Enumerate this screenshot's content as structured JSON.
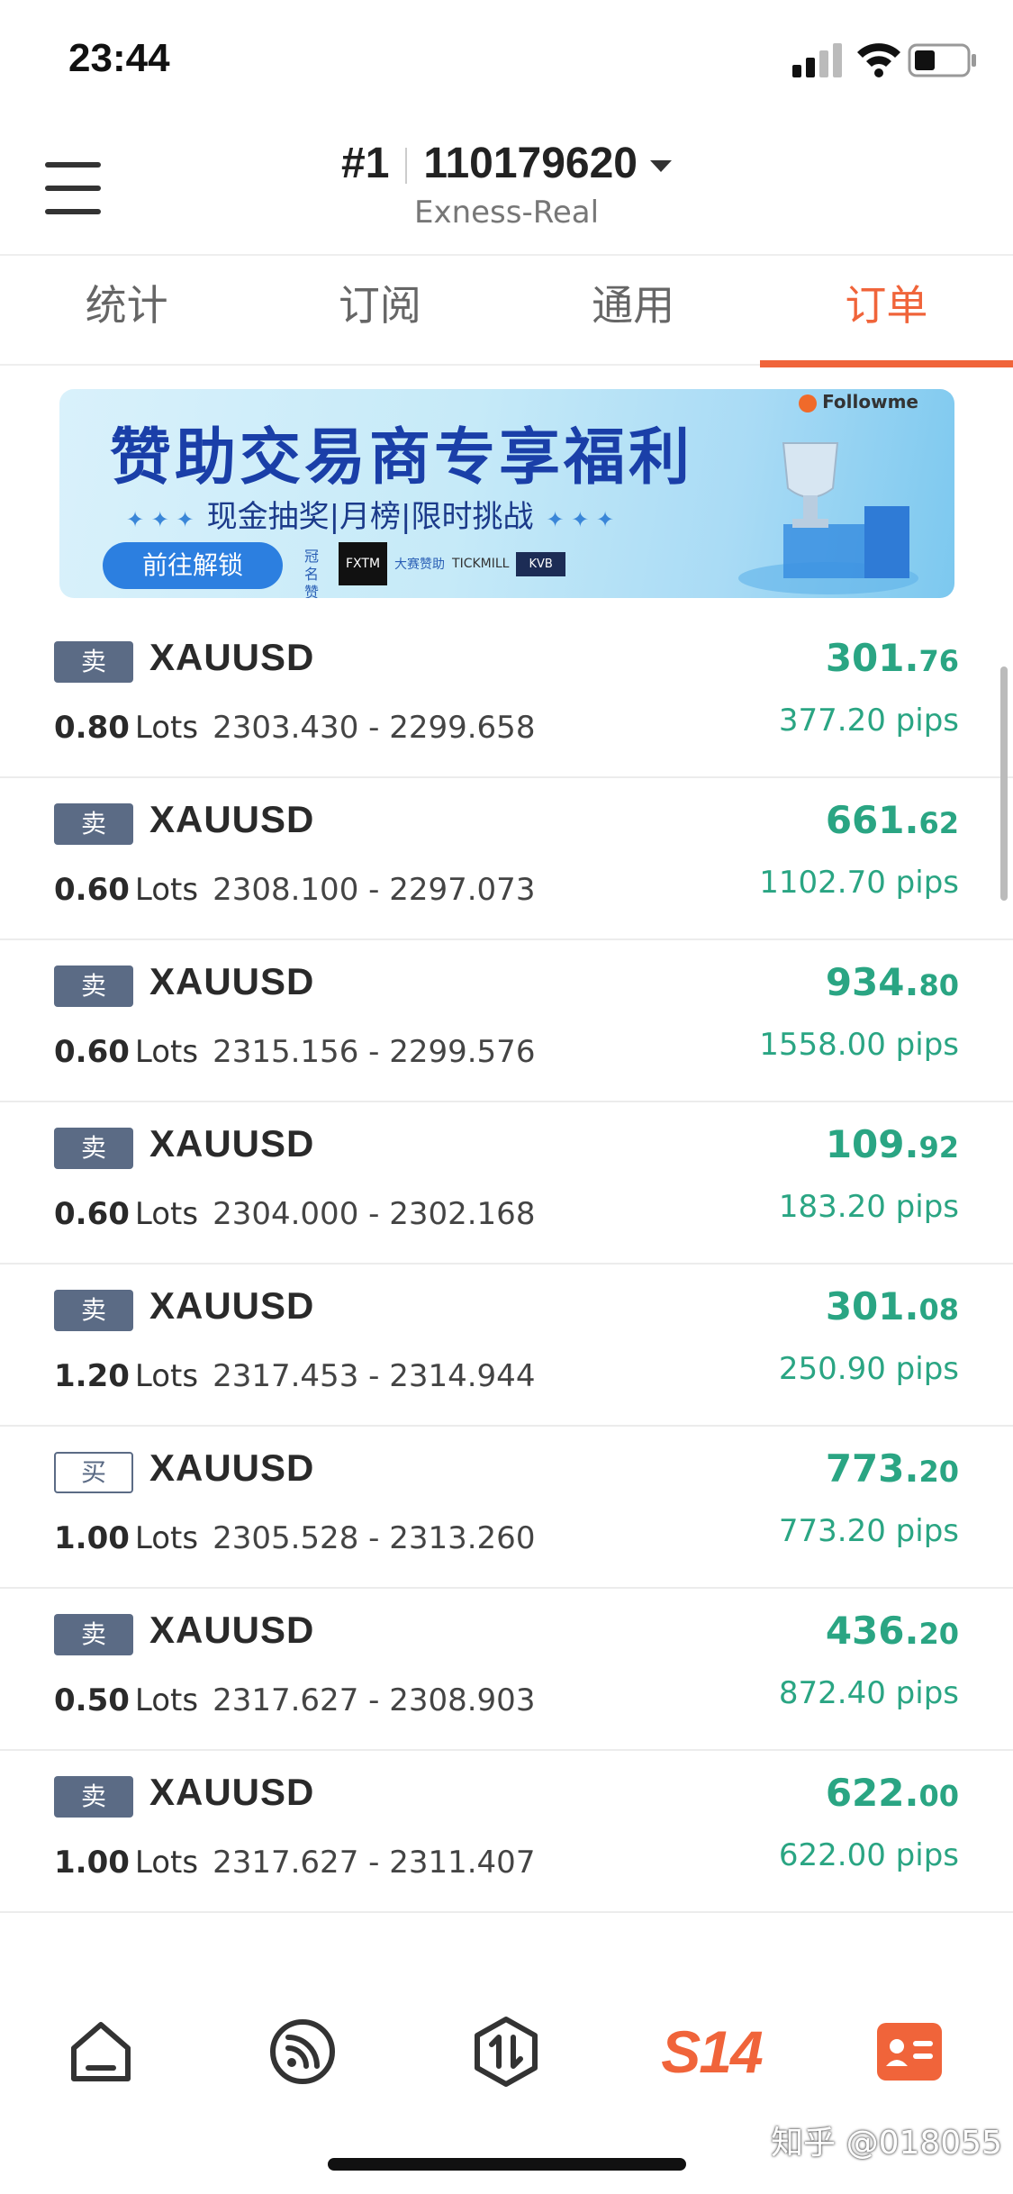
{
  "status_bar": {
    "time": "23:44"
  },
  "header": {
    "account_no": "#1",
    "account_id": "110179620",
    "server": "Exness-Real"
  },
  "tabs": [
    {
      "label": "统计",
      "active": false
    },
    {
      "label": "订阅",
      "active": false
    },
    {
      "label": "通用",
      "active": false
    },
    {
      "label": "订单",
      "active": true
    }
  ],
  "banner": {
    "brand": "Followme",
    "title": "赞助交易商专享福利",
    "subtitle": "现金抽奖|月榜|限时挑战",
    "button": "前往解锁",
    "sponsor_label": "冠名赞助",
    "logos": [
      "FXTM",
      "大赛赞助",
      "TICKMILL",
      "KVB"
    ]
  },
  "orders": [
    {
      "side": "卖",
      "side_type": "sell",
      "symbol": "XAUUSD",
      "lots": "0.80",
      "lots_label": "Lots",
      "open": "2303.430",
      "close": "2299.658",
      "profit_int": "301.",
      "profit_dec": "76",
      "pips": "377.20 pips"
    },
    {
      "side": "卖",
      "side_type": "sell",
      "symbol": "XAUUSD",
      "lots": "0.60",
      "lots_label": "Lots",
      "open": "2308.100",
      "close": "2297.073",
      "profit_int": "661.",
      "profit_dec": "62",
      "pips": "1102.70 pips"
    },
    {
      "side": "卖",
      "side_type": "sell",
      "symbol": "XAUUSD",
      "lots": "0.60",
      "lots_label": "Lots",
      "open": "2315.156",
      "close": "2299.576",
      "profit_int": "934.",
      "profit_dec": "80",
      "pips": "1558.00 pips"
    },
    {
      "side": "卖",
      "side_type": "sell",
      "symbol": "XAUUSD",
      "lots": "0.60",
      "lots_label": "Lots",
      "open": "2304.000",
      "close": "2302.168",
      "profit_int": "109.",
      "profit_dec": "92",
      "pips": "183.20 pips"
    },
    {
      "side": "卖",
      "side_type": "sell",
      "symbol": "XAUUSD",
      "lots": "1.20",
      "lots_label": "Lots",
      "open": "2317.453",
      "close": "2314.944",
      "profit_int": "301.",
      "profit_dec": "08",
      "pips": "250.90 pips"
    },
    {
      "side": "买",
      "side_type": "buy",
      "symbol": "XAUUSD",
      "lots": "1.00",
      "lots_label": "Lots",
      "open": "2305.528",
      "close": "2313.260",
      "profit_int": "773.",
      "profit_dec": "20",
      "pips": "773.20 pips"
    },
    {
      "side": "卖",
      "side_type": "sell",
      "symbol": "XAUUSD",
      "lots": "0.50",
      "lots_label": "Lots",
      "open": "2317.627",
      "close": "2308.903",
      "profit_int": "436.",
      "profit_dec": "20",
      "pips": "872.40 pips"
    },
    {
      "side": "卖",
      "side_type": "sell",
      "symbol": "XAUUSD",
      "lots": "1.00",
      "lots_label": "Lots",
      "open": "2317.627",
      "close": "2311.407",
      "profit_int": "622.",
      "profit_dec": "00",
      "pips": "622.00 pips"
    }
  ],
  "bottom_nav": {
    "items": [
      "home-icon",
      "feed-icon",
      "trade-icon",
      "s14-logo",
      "profile-card-icon"
    ],
    "s14_label": "S14"
  },
  "watermark": "知乎 @018055",
  "colors": {
    "accent": "#f0643a",
    "profit": "#2aa583",
    "sell_badge": "#5b6b85"
  }
}
